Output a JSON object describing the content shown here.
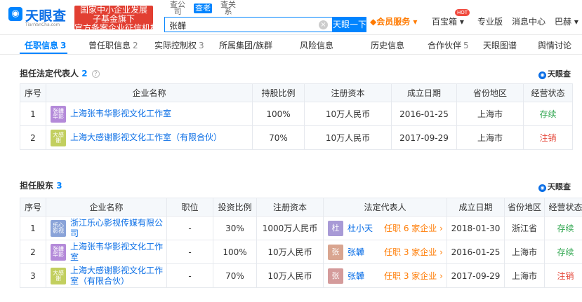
{
  "app": {
    "logo_text": "天眼查",
    "logo_sub": "TianYanCha.com",
    "promo_lines": [
      "国家中小企业发展",
      "子基金旗下",
      "官方备案企业征信机构"
    ],
    "search_tabs": [
      "查公司",
      "查老板",
      "查关系"
    ],
    "search_value": "张韡",
    "search_button": "天眼一下",
    "nav": {
      "vip": "会员服务",
      "baibao": "百宝箱",
      "hot": "HOT",
      "pro": "专业版",
      "msg": "消息中心",
      "user": "巴赫"
    }
  },
  "tabs": [
    {
      "label": "任职信息",
      "count": "3"
    },
    {
      "label": "曾任职信息",
      "count": "2"
    },
    {
      "label": "实际控制权",
      "count": "3"
    },
    {
      "label": "所属集团/族群",
      "count": ""
    },
    {
      "label": "风险信息",
      "count": ""
    },
    {
      "label": "历史信息",
      "count": ""
    },
    {
      "label": "合作伙伴",
      "count": "5"
    },
    {
      "label": "天眼图谱",
      "count": ""
    },
    {
      "label": "舆情讨论",
      "count": ""
    }
  ],
  "brand": "天眼查",
  "legal_section": {
    "title": "担任法定代表人",
    "count": "2",
    "headers": [
      "序号",
      "企业名称",
      "持股比例",
      "注册资本",
      "成立日期",
      "省份地区",
      "经营状态"
    ],
    "rows": [
      {
        "no": "1",
        "logo": "张韡华影",
        "logo_color": "#b48ad9",
        "name": "上海张韦华影视文化工作室",
        "share": "100%",
        "capital": "10万人民币",
        "date": "2016-01-25",
        "region": "上海市",
        "status": "存续"
      },
      {
        "no": "2",
        "logo": "大感谢",
        "logo_color": "#c2cf5f",
        "name": "上海大感谢影视文化工作室（有限合伙）",
        "share": "70%",
        "capital": "10万人民币",
        "date": "2017-09-29",
        "region": "上海市",
        "status": "注销"
      }
    ]
  },
  "holder_section": {
    "title": "担任股东",
    "count": "3",
    "headers": [
      "序号",
      "企业名称",
      "职位",
      "投资比例",
      "注册资本",
      "法定代表人",
      "成立日期",
      "省份地区",
      "经营状态"
    ],
    "rows": [
      {
        "no": "1",
        "logo": "乐心影视",
        "logo_color": "#8aa3d8",
        "name": "浙江乐心影视传媒有限公司",
        "position": "-",
        "ratio": "30%",
        "capital": "1000万人民币",
        "rep_avatar": "杜",
        "rep_color": "#a89ad6",
        "rep": "杜小天",
        "rel": "任职 6 家企业",
        "date": "2018-01-30",
        "region": "浙江省",
        "status": "存续"
      },
      {
        "no": "2",
        "logo": "张韡华影",
        "logo_color": "#b48ad9",
        "name": "上海张韦华影视文化工作室",
        "position": "-",
        "ratio": "100%",
        "capital": "10万人民币",
        "rep_avatar": "张",
        "rep_color": "#d9a590",
        "rep": "张韡",
        "rel": "任职 3 家企业",
        "date": "2016-01-25",
        "region": "上海市",
        "status": "存续"
      },
      {
        "no": "3",
        "logo": "大感谢",
        "logo_color": "#c2cf5f",
        "name": "上海大感谢影视文化工作室（有限合伙）",
        "position": "-",
        "ratio": "70%",
        "capital": "10万人民币",
        "rep_avatar": "张",
        "rep_color": "#d49b9b",
        "rep": "张韡",
        "rel": "任职 3 家企业",
        "date": "2017-09-29",
        "region": "上海市",
        "status": "注销"
      }
    ]
  }
}
